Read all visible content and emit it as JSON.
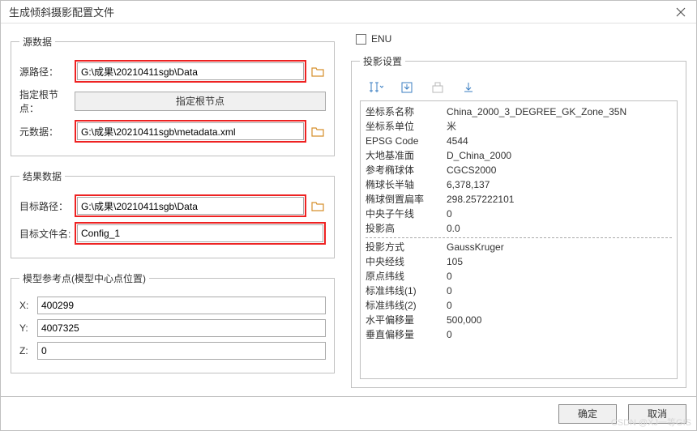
{
  "window": {
    "title": "生成倾斜摄影配置文件"
  },
  "source": {
    "legend": "源数据",
    "source_path_label": "源路径：",
    "source_path_value": "G:\\成果\\20210411sgb\\Data",
    "root_node_label": "指定根节点：",
    "root_node_button": "指定根节点",
    "metadata_label": "元数据：",
    "metadata_value": "G:\\成果\\20210411sgb\\metadata.xml"
  },
  "result": {
    "legend": "结果数据",
    "target_path_label": "目标路径：",
    "target_path_value": "G:\\成果\\20210411sgb\\Data",
    "target_file_label": "目标文件名:",
    "target_file_value": "Config_1"
  },
  "modelref": {
    "legend": "模型参考点(模型中心点位置)",
    "x_label": "X:",
    "x_value": "400299",
    "y_label": "Y:",
    "y_value": "4007325",
    "z_label": "Z:",
    "z_value": "0"
  },
  "enu": {
    "label": "ENU",
    "checked": false
  },
  "projection": {
    "legend": "投影设置",
    "rows1": [
      {
        "k": "坐标系名称",
        "v": "China_2000_3_DEGREE_GK_Zone_35N"
      },
      {
        "k": "坐标系单位",
        "v": "米"
      },
      {
        "k": "EPSG Code",
        "v": "4544"
      },
      {
        "k": "大地基准面",
        "v": "D_China_2000"
      },
      {
        "k": "参考椭球体",
        "v": "CGCS2000"
      },
      {
        "k": "椭球长半轴",
        "v": "6,378,137"
      },
      {
        "k": "椭球倒置扁率",
        "v": "298.257222101"
      },
      {
        "k": "中央子午线",
        "v": "0"
      },
      {
        "k": "投影高",
        "v": "0.0"
      }
    ],
    "rows2": [
      {
        "k": "投影方式",
        "v": "GaussKruger"
      },
      {
        "k": "中央经线",
        "v": "105"
      },
      {
        "k": "原点纬线",
        "v": "0"
      },
      {
        "k": "标准纬线(1)",
        "v": "0"
      },
      {
        "k": "标准纬线(2)",
        "v": "0"
      },
      {
        "k": "水平偏移量",
        "v": "500,000"
      },
      {
        "k": "垂直偏移量",
        "v": "0"
      }
    ]
  },
  "footer": {
    "ok": "确定",
    "cancel": "取消"
  },
  "watermark": "CSDN @XJ一等GIS"
}
